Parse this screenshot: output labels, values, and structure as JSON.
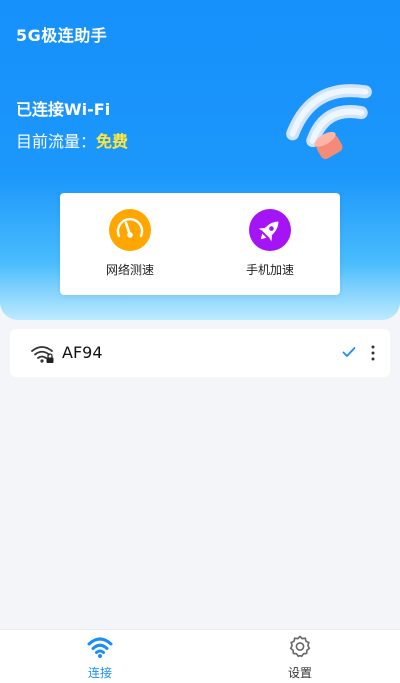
{
  "app": {
    "title": "5G极连助手"
  },
  "status": {
    "wifi_text": "已连接Wi-Fi",
    "traffic_label": "目前流量：",
    "traffic_value": "免费"
  },
  "tools": [
    {
      "label": "网络测速",
      "icon": "speedometer-icon",
      "color": "#ffa700"
    },
    {
      "label": "手机加速",
      "icon": "rocket-icon",
      "color": "#a514f4"
    }
  ],
  "wifi_list": [
    {
      "ssid": "AF94",
      "signal_icon": "wifi-locked-icon",
      "connected": true,
      "accent": "#1a8ef7"
    }
  ],
  "bottom_nav": [
    {
      "label": "连接",
      "icon": "wifi-icon",
      "active": true,
      "color": "#1a8ef7"
    },
    {
      "label": "设置",
      "icon": "gear-icon",
      "active": false,
      "color": "#333333"
    }
  ]
}
